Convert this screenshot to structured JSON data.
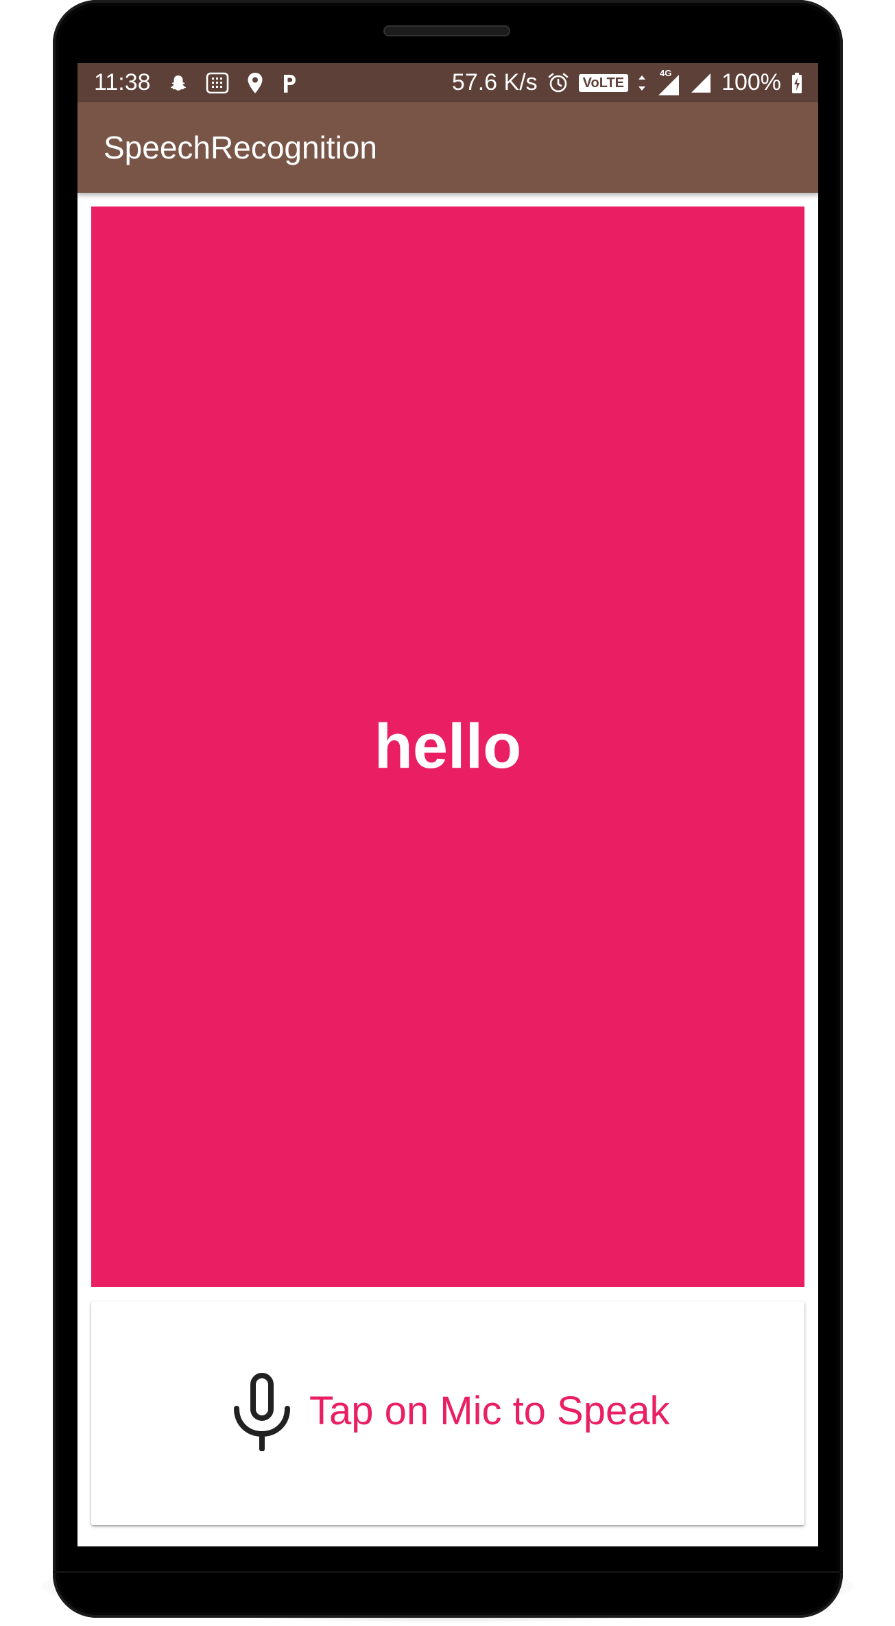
{
  "device": {
    "frame_color": "#000000"
  },
  "status_bar": {
    "time": "11:38",
    "network_speed": "57.6 K/s",
    "volte": "VoLTE",
    "network_type": "4G",
    "battery": "100%",
    "background": "#5d4037",
    "icons_left": [
      "snapchat-icon",
      "sim-toolkit-icon",
      "location-pin-icon",
      "p-app-icon"
    ],
    "icons_right": [
      "alarm-icon",
      "volte-icon",
      "data-arrows-icon",
      "signal-4g-icon",
      "signal-icon",
      "battery-charging-icon"
    ]
  },
  "app_bar": {
    "title": "SpeechRecognition",
    "background": "#795548"
  },
  "result": {
    "text": "hello",
    "background": "#e91e63"
  },
  "mic_button": {
    "label": "Tap on Mic to Speak",
    "icon": "microphone-icon",
    "label_color": "#e91e63"
  }
}
